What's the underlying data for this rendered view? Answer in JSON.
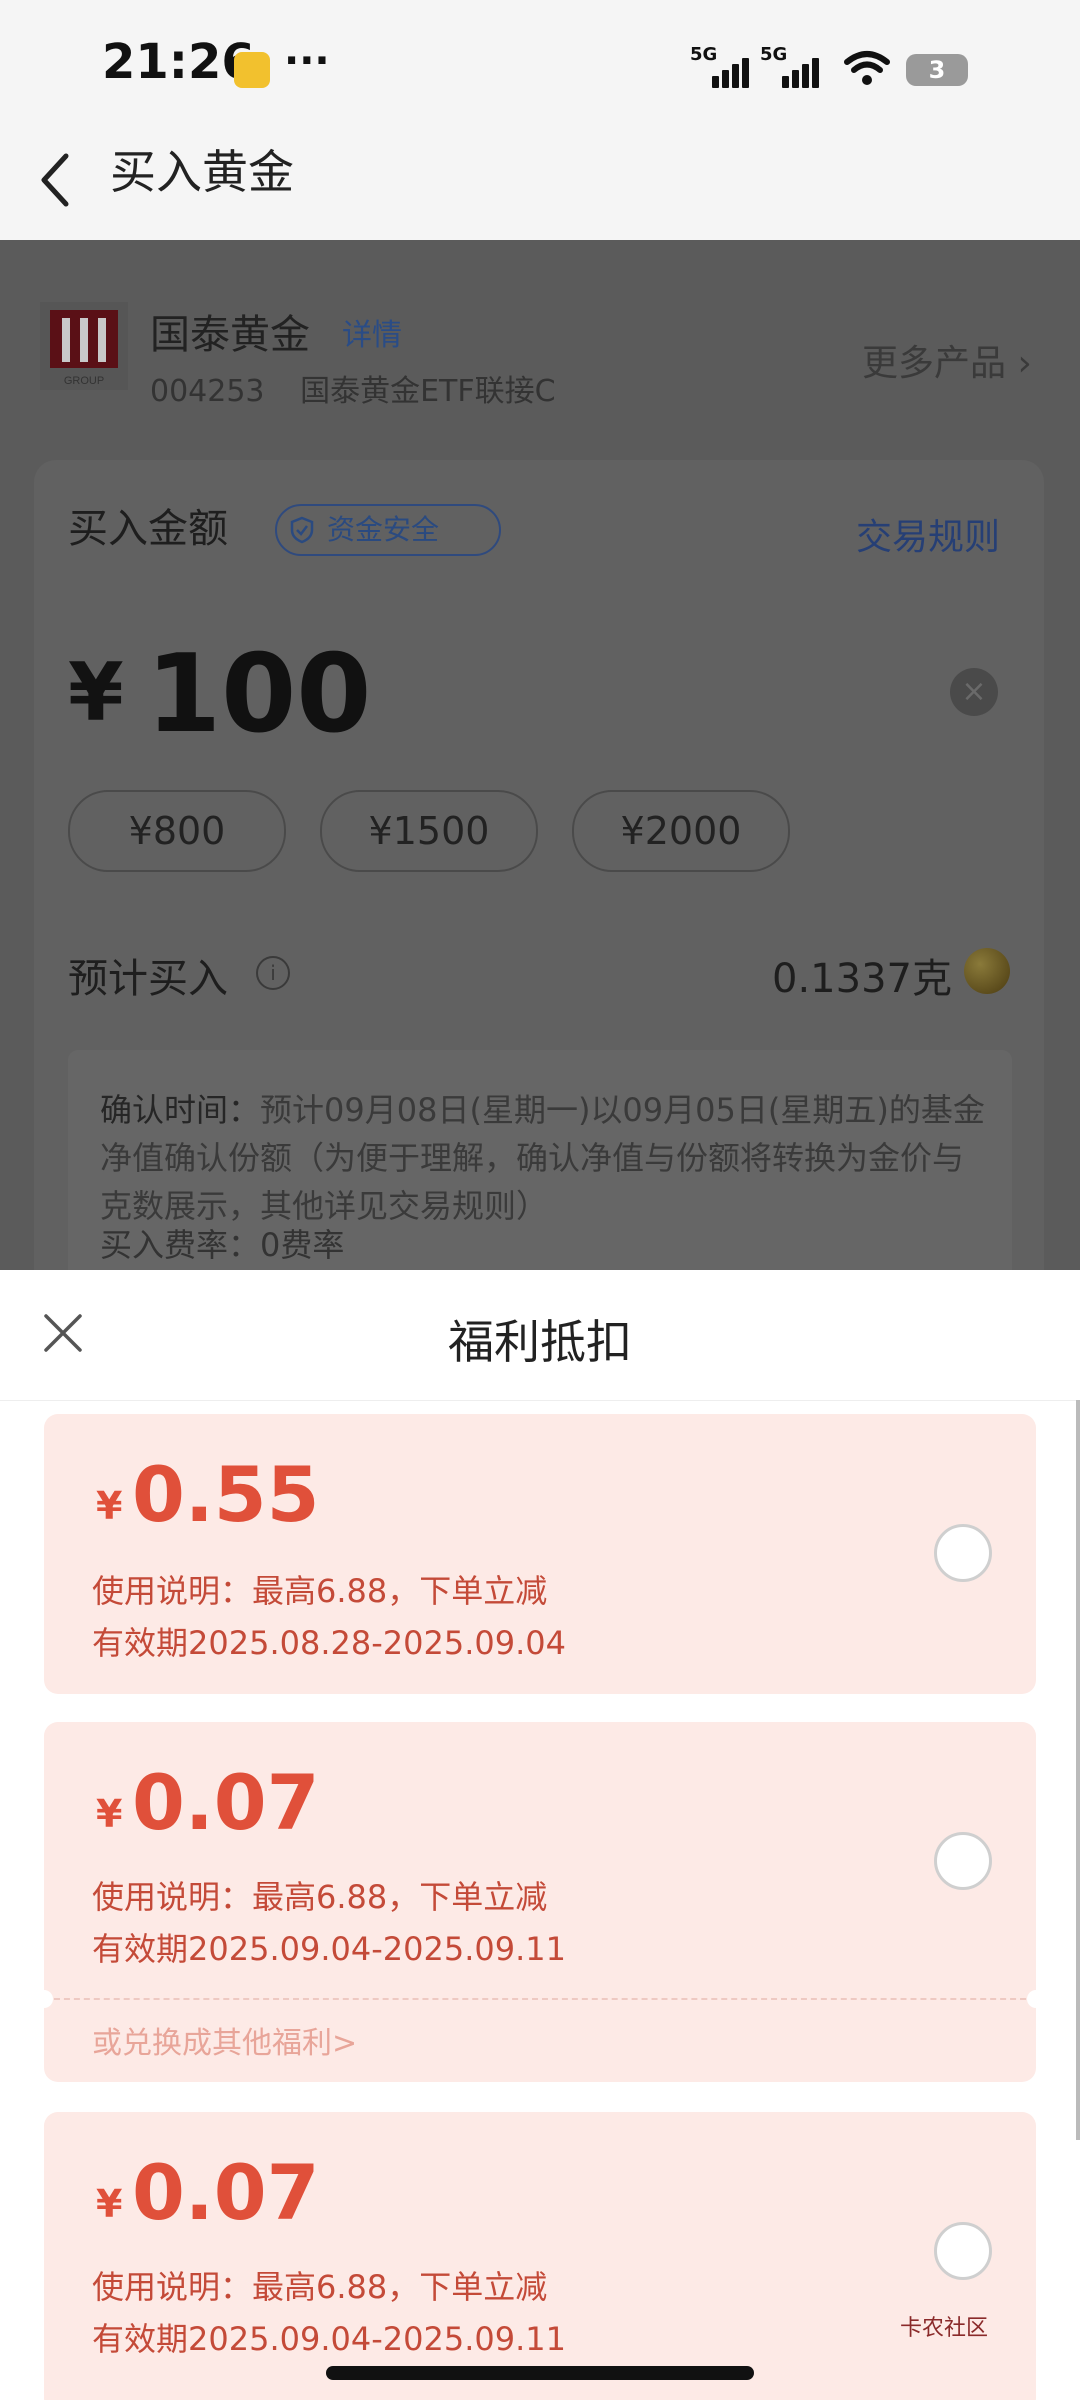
{
  "status_bar": {
    "time": "21:26",
    "dots": "···",
    "network1": "5G",
    "network2": "5G",
    "battery": "3"
  },
  "nav": {
    "title": "买入黄金"
  },
  "fund": {
    "name": "国泰黄金",
    "detail_link": "详情",
    "code": "004253",
    "fullname": "国泰黄金ETF联接C",
    "more": "更多产品",
    "logo_caption": "GROUP"
  },
  "buy": {
    "label": "买入金额",
    "safe_badge": "资金安全",
    "rules_link": "交易规则",
    "currency": "¥",
    "amount": "100",
    "chips": [
      "¥800",
      "¥1500",
      "¥2000"
    ],
    "estimate_label": "预计买入",
    "estimate_value": "0.1337克",
    "confirm_label": "确认时间：",
    "confirm_text": "预计09月08日(星期一)以09月05日(星期五)的基金净值确认份额（为便于理解，确认净值与份额将转换为金价与克数展示，其他详见交易规则）",
    "fee_text": "买入费率：0费率"
  },
  "sheet": {
    "title": "福利抵扣",
    "coupons": [
      {
        "currency": "¥",
        "amount": "0.55",
        "desc": "使用说明：最高6.88，下单立减",
        "validity": "有效期2025.08.28-2025.09.04"
      },
      {
        "currency": "¥",
        "amount": "0.07",
        "desc": "使用说明：最高6.88，下单立减",
        "validity": "有效期2025.09.04-2025.09.11",
        "exchange": "或兑换成其他福利>"
      },
      {
        "currency": "¥",
        "amount": "0.07",
        "desc": "使用说明：最高6.88，下单立减",
        "validity": "有效期2025.09.04-2025.09.11"
      }
    ]
  },
  "watermark": "卡农社区",
  "colors": {
    "coupon_red": "#e0503a",
    "coupon_bg": "#fdeae6",
    "link_blue": "#2a4c86"
  },
  "icons": [
    "back-chevron-icon",
    "shield-check-icon",
    "info-icon",
    "clear-icon",
    "close-icon",
    "radio-icon"
  ]
}
